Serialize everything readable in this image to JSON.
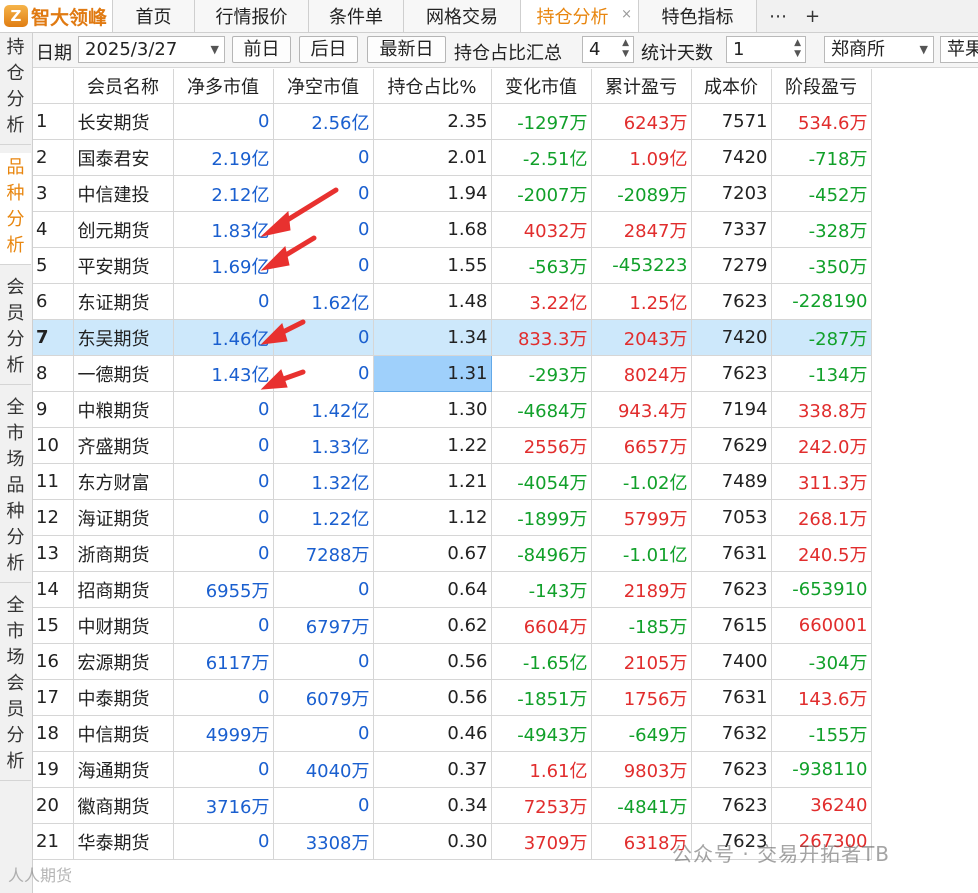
{
  "tabs": {
    "logo_text": "智大领峰",
    "items": [
      {
        "label": "首页",
        "active": false
      },
      {
        "label": "行情报价",
        "active": false
      },
      {
        "label": "条件单",
        "active": false
      },
      {
        "label": "网格交易",
        "active": false
      },
      {
        "label": "持仓分析",
        "active": true
      },
      {
        "label": "特色指标",
        "active": false
      }
    ],
    "close_glyph": "×",
    "more_glyph": "⋯",
    "add_glyph": "+"
  },
  "sidenav": [
    {
      "label": "持仓分析",
      "active": false
    },
    {
      "label": "品种分析",
      "active": true
    },
    {
      "label": "会员分析",
      "active": false
    },
    {
      "label": "全市场品种分析",
      "active": false
    },
    {
      "label": "全市场会员分析",
      "active": false
    }
  ],
  "toolbar": {
    "date_label": "日期",
    "date_value": "2025/3/27",
    "prev_label": "前日",
    "next_label": "后日",
    "latest_label": "最新日",
    "summary_label": "持仓占比汇总",
    "summary_value": "4",
    "days_label": "统计天数",
    "days_value": "1",
    "exchange_value": "郑商所",
    "product_value": "苹果"
  },
  "table": {
    "headers": [
      "",
      "会员名称",
      "净多市值",
      "净空市值",
      "持仓占比%",
      "变化市值",
      "累计盈亏",
      "成本价",
      "阶段盈亏"
    ],
    "rows": [
      {
        "idx": "1",
        "name": "长安期货",
        "long": "0",
        "short": "2.56亿",
        "pct": "2.35",
        "chg": "-1297万",
        "chg_c": "green",
        "cum": "6243万",
        "cum_c": "red",
        "cost": "7571",
        "stage": "534.6万",
        "stage_c": "red"
      },
      {
        "idx": "2",
        "name": "国泰君安",
        "long": "2.19亿",
        "short": "0",
        "pct": "2.01",
        "chg": "-2.51亿",
        "chg_c": "green",
        "cum": "1.09亿",
        "cum_c": "red",
        "cost": "7420",
        "stage": "-718万",
        "stage_c": "green"
      },
      {
        "idx": "3",
        "name": "中信建投",
        "long": "2.12亿",
        "short": "0",
        "pct": "1.94",
        "chg": "-2007万",
        "chg_c": "green",
        "cum": "-2089万",
        "cum_c": "green",
        "cost": "7203",
        "stage": "-452万",
        "stage_c": "green"
      },
      {
        "idx": "4",
        "name": "创元期货",
        "long": "1.83亿",
        "short": "0",
        "pct": "1.68",
        "chg": "4032万",
        "chg_c": "red",
        "cum": "2847万",
        "cum_c": "red",
        "cost": "7337",
        "stage": "-328万",
        "stage_c": "green"
      },
      {
        "idx": "5",
        "name": "平安期货",
        "long": "1.69亿",
        "short": "0",
        "pct": "1.55",
        "chg": "-563万",
        "chg_c": "green",
        "cum": "-453223",
        "cum_c": "green",
        "cost": "7279",
        "stage": "-350万",
        "stage_c": "green"
      },
      {
        "idx": "6",
        "name": "东证期货",
        "long": "0",
        "short": "1.62亿",
        "pct": "1.48",
        "chg": "3.22亿",
        "chg_c": "red",
        "cum": "1.25亿",
        "cum_c": "red",
        "cost": "7623",
        "stage": "-228190",
        "stage_c": "green"
      },
      {
        "idx": "7",
        "name": "东吴期货",
        "long": "1.46亿",
        "short": "0",
        "pct": "1.34",
        "chg": "833.3万",
        "chg_c": "red",
        "cum": "2043万",
        "cum_c": "red",
        "cost": "7420",
        "stage": "-287万",
        "stage_c": "green"
      },
      {
        "idx": "8",
        "name": "一德期货",
        "long": "1.43亿",
        "short": "0",
        "pct": "1.31",
        "chg": "-293万",
        "chg_c": "green",
        "cum": "8024万",
        "cum_c": "red",
        "cost": "7623",
        "stage": "-134万",
        "stage_c": "green"
      },
      {
        "idx": "9",
        "name": "中粮期货",
        "long": "0",
        "short": "1.42亿",
        "pct": "1.30",
        "chg": "-4684万",
        "chg_c": "green",
        "cum": "943.4万",
        "cum_c": "red",
        "cost": "7194",
        "stage": "338.8万",
        "stage_c": "red"
      },
      {
        "idx": "10",
        "name": "齐盛期货",
        "long": "0",
        "short": "1.33亿",
        "pct": "1.22",
        "chg": "2556万",
        "chg_c": "red",
        "cum": "6657万",
        "cum_c": "red",
        "cost": "7629",
        "stage": "242.0万",
        "stage_c": "red"
      },
      {
        "idx": "11",
        "name": "东方财富",
        "long": "0",
        "short": "1.32亿",
        "pct": "1.21",
        "chg": "-4054万",
        "chg_c": "green",
        "cum": "-1.02亿",
        "cum_c": "green",
        "cost": "7489",
        "stage": "311.3万",
        "stage_c": "red"
      },
      {
        "idx": "12",
        "name": "海证期货",
        "long": "0",
        "short": "1.22亿",
        "pct": "1.12",
        "chg": "-1899万",
        "chg_c": "green",
        "cum": "5799万",
        "cum_c": "red",
        "cost": "7053",
        "stage": "268.1万",
        "stage_c": "red"
      },
      {
        "idx": "13",
        "name": "浙商期货",
        "long": "0",
        "short": "7288万",
        "pct": "0.67",
        "chg": "-8496万",
        "chg_c": "green",
        "cum": "-1.01亿",
        "cum_c": "green",
        "cost": "7631",
        "stage": "240.5万",
        "stage_c": "red"
      },
      {
        "idx": "14",
        "name": "招商期货",
        "long": "6955万",
        "short": "0",
        "pct": "0.64",
        "chg": "-143万",
        "chg_c": "green",
        "cum": "2189万",
        "cum_c": "red",
        "cost": "7623",
        "stage": "-653910",
        "stage_c": "green"
      },
      {
        "idx": "15",
        "name": "中财期货",
        "long": "0",
        "short": "6797万",
        "pct": "0.62",
        "chg": "6604万",
        "chg_c": "red",
        "cum": "-185万",
        "cum_c": "green",
        "cost": "7615",
        "stage": "660001",
        "stage_c": "red"
      },
      {
        "idx": "16",
        "name": "宏源期货",
        "long": "6117万",
        "short": "0",
        "pct": "0.56",
        "chg": "-1.65亿",
        "chg_c": "green",
        "cum": "2105万",
        "cum_c": "red",
        "cost": "7400",
        "stage": "-304万",
        "stage_c": "green"
      },
      {
        "idx": "17",
        "name": "中泰期货",
        "long": "0",
        "short": "6079万",
        "pct": "0.56",
        "chg": "-1851万",
        "chg_c": "green",
        "cum": "1756万",
        "cum_c": "red",
        "cost": "7631",
        "stage": "143.6万",
        "stage_c": "red"
      },
      {
        "idx": "18",
        "name": "中信期货",
        "long": "4999万",
        "short": "0",
        "pct": "0.46",
        "chg": "-4943万",
        "chg_c": "green",
        "cum": "-649万",
        "cum_c": "green",
        "cost": "7632",
        "stage": "-155万",
        "stage_c": "green"
      },
      {
        "idx": "19",
        "name": "海通期货",
        "long": "0",
        "short": "4040万",
        "pct": "0.37",
        "chg": "1.61亿",
        "chg_c": "red",
        "cum": "9803万",
        "cum_c": "red",
        "cost": "7623",
        "stage": "-938110",
        "stage_c": "green"
      },
      {
        "idx": "20",
        "name": "徽商期货",
        "long": "3716万",
        "short": "0",
        "pct": "0.34",
        "chg": "7253万",
        "chg_c": "red",
        "cum": "-4841万",
        "cum_c": "green",
        "cost": "7623",
        "stage": "36240",
        "stage_c": "red"
      },
      {
        "idx": "21",
        "name": "华泰期货",
        "long": "0",
        "short": "3308万",
        "pct": "0.30",
        "chg": "3709万",
        "chg_c": "red",
        "cum": "6318万",
        "cum_c": "red",
        "cost": "7623",
        "stage": "267300",
        "stage_c": "red"
      }
    ]
  },
  "watermark": "公众号 · 交易开拓者TB",
  "watermark2": "人人期货",
  "colors": {
    "accent": "#e8860f",
    "blue": "#1a5fcf",
    "red": "#e12d2d",
    "green": "#11a02a",
    "selected_row": "#cde8fb",
    "arrow": "#e8312f"
  }
}
